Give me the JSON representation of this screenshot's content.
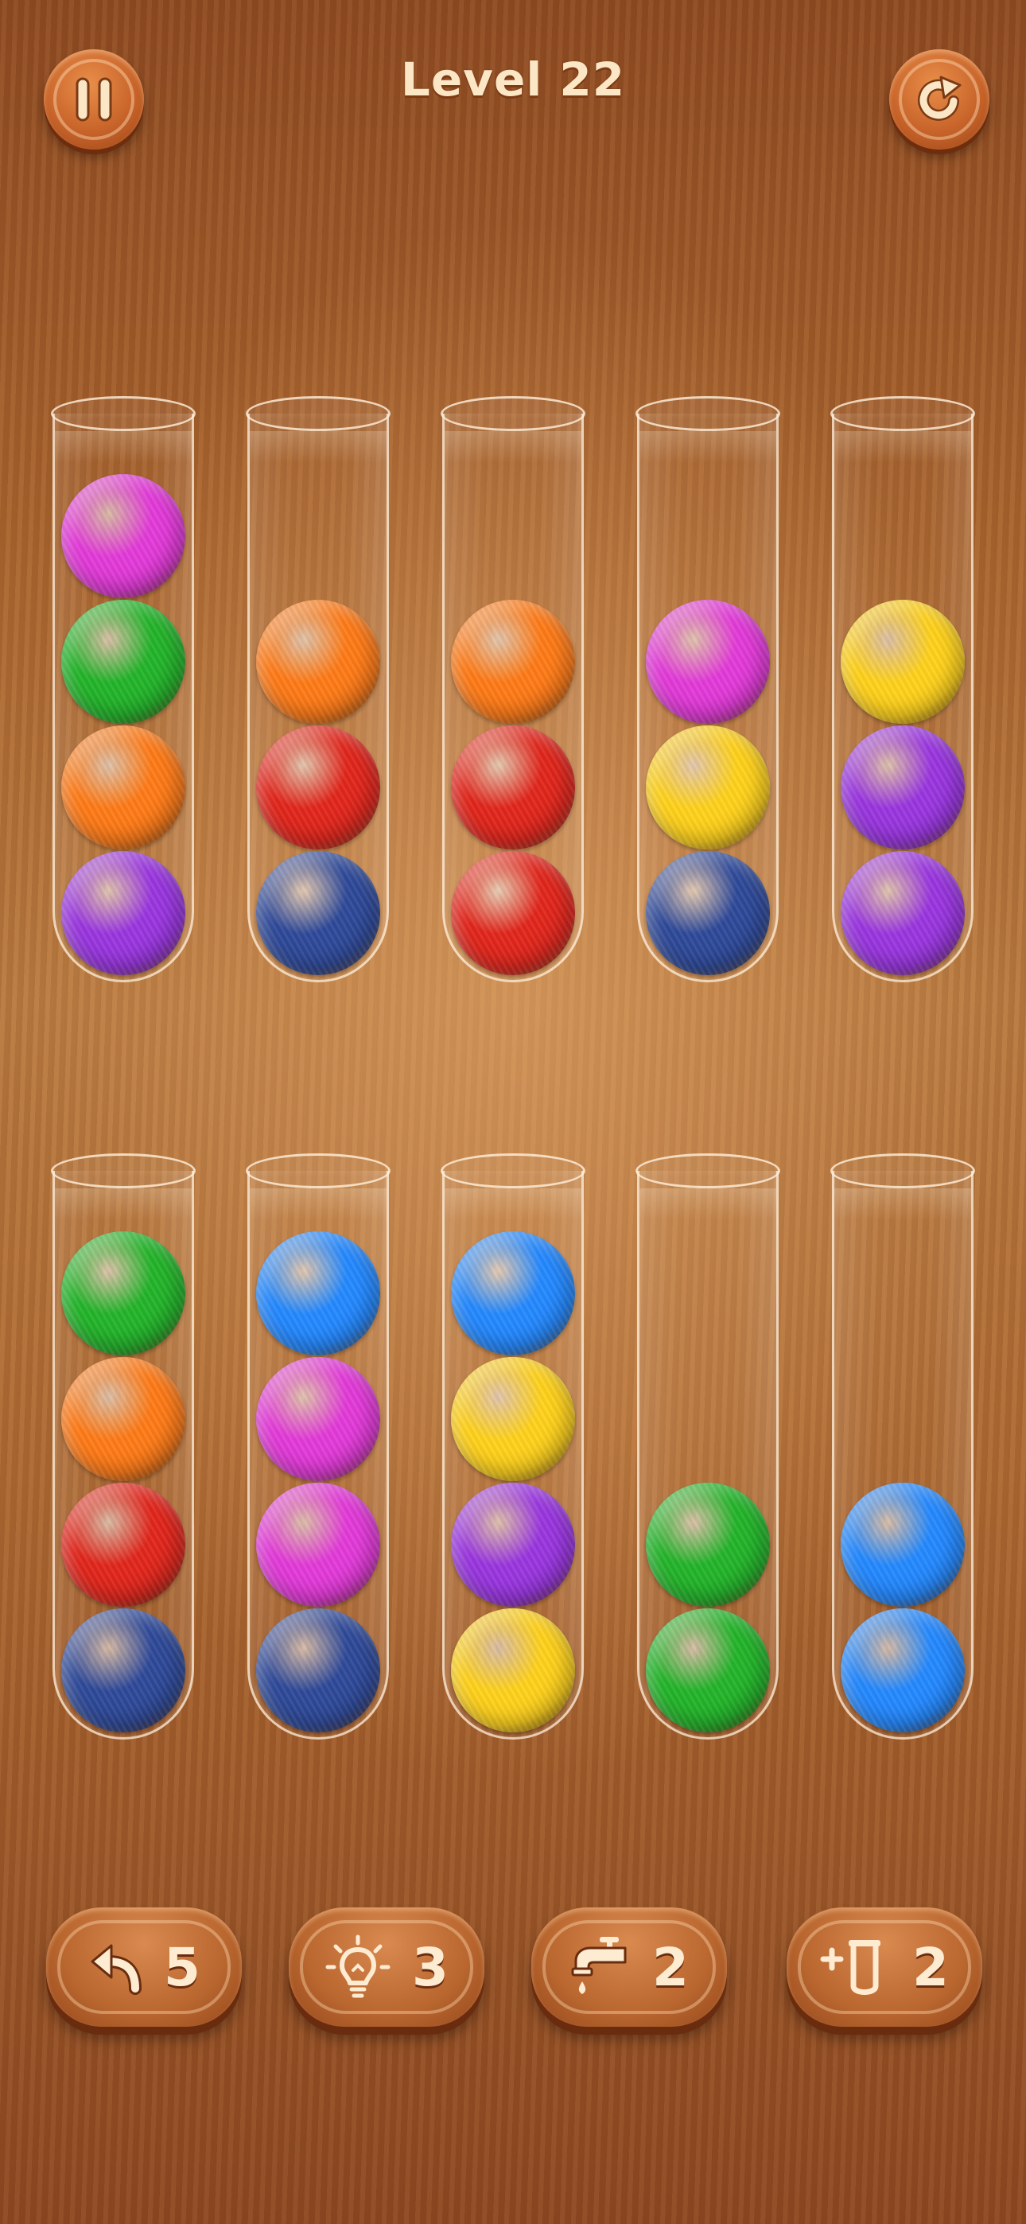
{
  "header": {
    "title": "Level 22",
    "pause_icon": "pause-icon",
    "restart_icon": "restart-icon"
  },
  "colors": {
    "magenta": "#e33ad9",
    "green": "#23b52a",
    "orange": "#ff7b17",
    "purple": "#9a36e0",
    "red": "#e2261c",
    "navy": "#2f4a9a",
    "yellow": "#ffd21c",
    "blue": "#2489ff"
  },
  "tubes": [
    {
      "row": 1,
      "balls_top_to_bottom": [
        "magenta",
        "green",
        "orange",
        "purple"
      ]
    },
    {
      "row": 1,
      "balls_top_to_bottom": [
        "orange",
        "red",
        "navy"
      ]
    },
    {
      "row": 1,
      "balls_top_to_bottom": [
        "orange",
        "red",
        "red"
      ]
    },
    {
      "row": 1,
      "balls_top_to_bottom": [
        "magenta",
        "yellow",
        "navy"
      ]
    },
    {
      "row": 1,
      "balls_top_to_bottom": [
        "yellow",
        "purple",
        "purple"
      ]
    },
    {
      "row": 2,
      "balls_top_to_bottom": [
        "green",
        "orange",
        "red",
        "navy"
      ]
    },
    {
      "row": 2,
      "balls_top_to_bottom": [
        "blue",
        "magenta",
        "magenta",
        "navy"
      ]
    },
    {
      "row": 2,
      "balls_top_to_bottom": [
        "blue",
        "yellow",
        "purple",
        "yellow"
      ]
    },
    {
      "row": 2,
      "balls_top_to_bottom": [
        "green",
        "green"
      ]
    },
    {
      "row": 2,
      "balls_top_to_bottom": [
        "blue",
        "blue"
      ]
    }
  ],
  "tools": {
    "undo": {
      "icon": "undo-icon",
      "count": "5"
    },
    "hint": {
      "icon": "lightbulb-icon",
      "count": "3"
    },
    "pour": {
      "icon": "faucet-icon",
      "count": "2"
    },
    "add_tube": {
      "icon": "add-tube-icon",
      "count": "2"
    }
  }
}
